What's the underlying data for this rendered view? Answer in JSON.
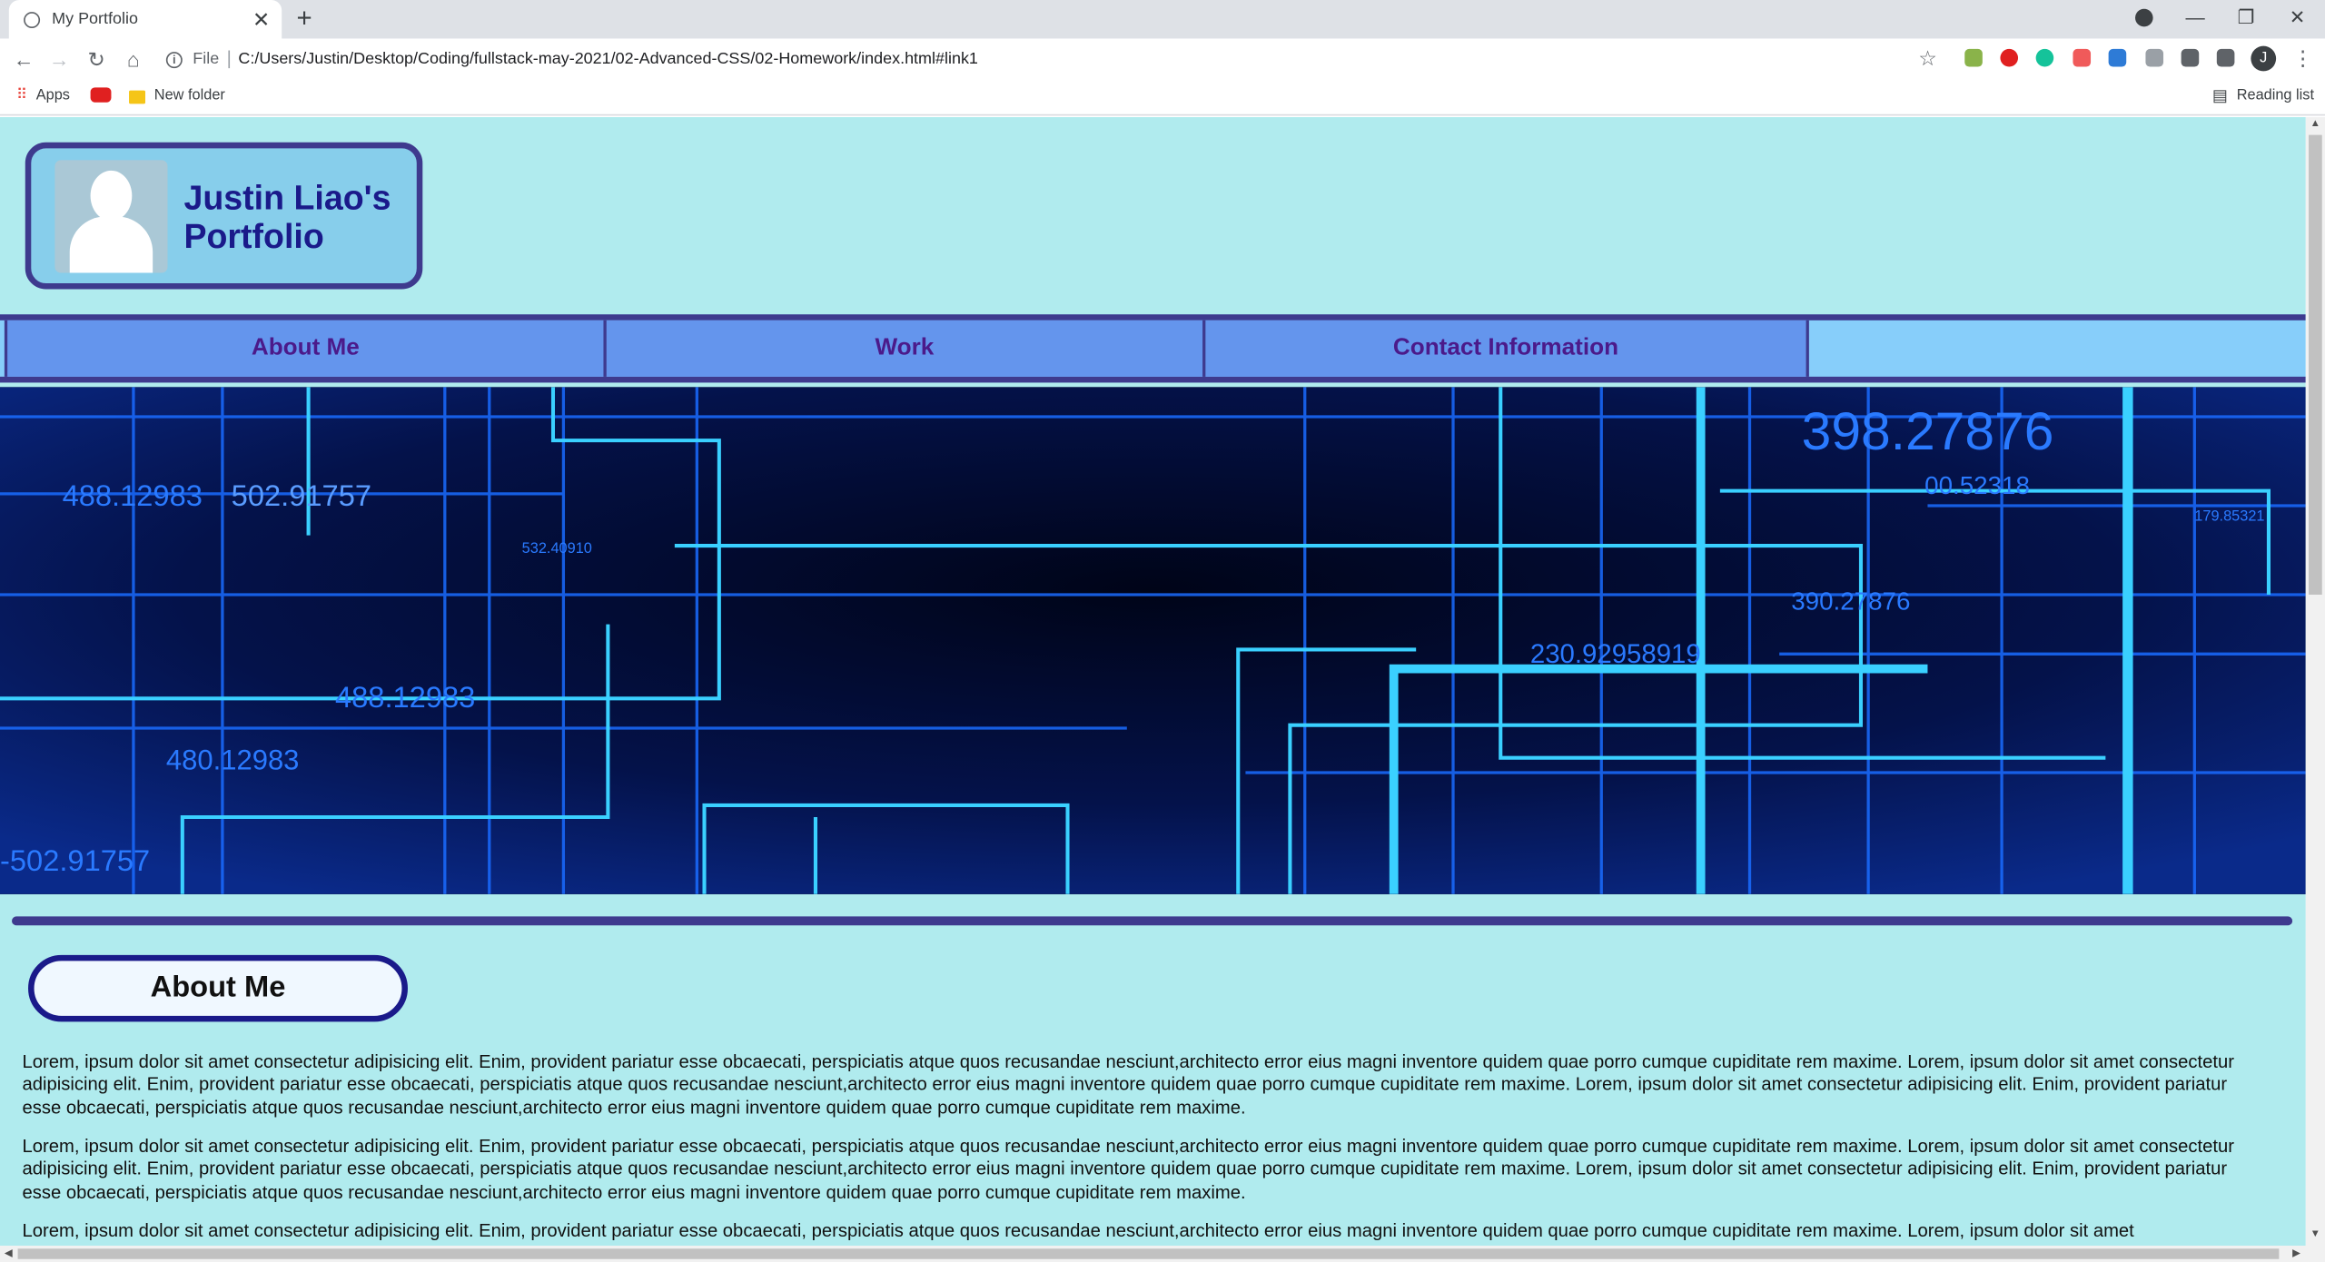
{
  "browser": {
    "tab_title": "My Portfolio",
    "new_tab": "+",
    "url_scheme": "File",
    "url": "C:/Users/Justin/Desktop/Coding/fullstack-may-2021/02-Advanced-CSS/02-Homework/index.html#link1",
    "profile_initial": "J",
    "bookmarks": {
      "apps": "Apps",
      "folder": "New folder",
      "reading_list": "Reading list"
    }
  },
  "header": {
    "title_line1": "Justin Liao's",
    "title_line2": "Portfolio"
  },
  "nav": {
    "items": [
      "About Me",
      "Work",
      "Contact Information"
    ]
  },
  "hero": {
    "labels": [
      "488.12983",
      "502.91757",
      "488.12983",
      "480.12983",
      "-502.91757",
      "398.27876",
      "230.92958919",
      "532.40910",
      "179.85321",
      "390.27876",
      "00.52318"
    ]
  },
  "about": {
    "heading": "About Me",
    "paragraph": "Lorem, ipsum dolor sit amet consectetur adipisicing elit. Enim, provident pariatur esse obcaecati, perspiciatis atque quos recusandae nesciunt,architecto error eius magni inventore quidem quae porro cumque cupiditate rem maxime. Lorem, ipsum dolor sit amet consectetur adipisicing elit. Enim, provident pariatur esse obcaecati, perspiciatis atque quos recusandae nesciunt,architecto error eius magni inventore quidem quae porro cumque cupiditate rem maxime. Lorem, ipsum dolor sit amet consectetur adipisicing elit. Enim, provident pariatur esse obcaecati, perspiciatis atque quos recusandae nesciunt,architecto error eius magni inventore quidem quae porro cumque cupiditate rem maxime.",
    "paragraph_partial": "Lorem, ipsum dolor sit amet consectetur adipisicing elit. Enim, provident pariatur esse obcaecati, perspiciatis atque quos recusandae nesciunt,architecto error eius magni inventore quidem quae porro cumque cupiditate rem maxime. Lorem, ipsum dolor sit amet"
  },
  "colors": {
    "page_bg": "#b0ebee",
    "border": "#3e3a8e",
    "nav_item": "#6495ed",
    "nav_bar": "#87cefa",
    "heading_text": "#1a1a8a"
  }
}
